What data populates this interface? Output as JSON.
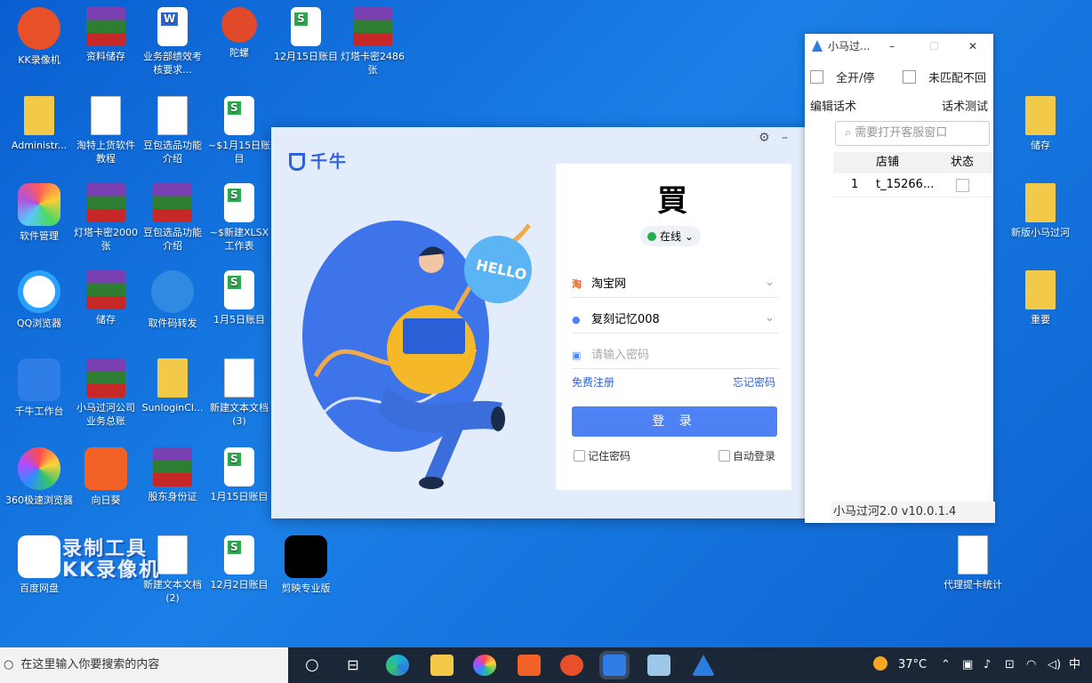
{
  "desktop_icons": [
    {
      "label": "KK录像机",
      "icon": "kk-recorder-icon"
    },
    {
      "label": "资料储存",
      "icon": "winrar-archive-icon"
    },
    {
      "label": "业务部绩效考核要求...",
      "icon": "word-doc-icon"
    },
    {
      "label": "陀螺",
      "icon": "spinning-top-icon"
    },
    {
      "label": "12月15日账目",
      "icon": "spreadsheet-icon"
    },
    {
      "label": "灯塔卡密2486张",
      "icon": "winrar-archive-icon"
    },
    {
      "label": "Administr...",
      "icon": "user-folder-icon"
    },
    {
      "label": "淘特上货软件教程",
      "icon": "video-file-icon"
    },
    {
      "label": "豆包选品功能介绍",
      "icon": "video-file-icon"
    },
    {
      "label": "~$1月15日账目",
      "icon": "spreadsheet-icon"
    },
    {
      "label": "软件管理",
      "icon": "software-manager-icon"
    },
    {
      "label": "灯塔卡密2000张",
      "icon": "winrar-archive-icon"
    },
    {
      "label": "豆包选品功能介绍",
      "icon": "winrar-archive-icon"
    },
    {
      "label": "~$新建XLSX 工作表",
      "icon": "spreadsheet-icon"
    },
    {
      "label": "QQ浏览器",
      "icon": "qq-browser-icon"
    },
    {
      "label": "储存",
      "icon": "winrar-archive-icon"
    },
    {
      "label": "取件码转发",
      "icon": "send-app-icon"
    },
    {
      "label": "1月5日账目",
      "icon": "spreadsheet-icon"
    },
    {
      "label": "千牛工作台",
      "icon": "qianniu-icon"
    },
    {
      "label": "小马过河公司业务总账",
      "icon": "winrar-archive-icon"
    },
    {
      "label": "SunloginCl...",
      "icon": "folder-icon"
    },
    {
      "label": "新建文本文档 (3)",
      "icon": "text-file-icon"
    },
    {
      "label": "360极速浏览器",
      "icon": "360-browser-icon"
    },
    {
      "label": "向日葵",
      "icon": "sunlogin-icon"
    },
    {
      "label": "股东身份证",
      "icon": "winrar-archive-icon"
    },
    {
      "label": "1月15日账目",
      "icon": "spreadsheet-icon"
    },
    {
      "label": "百度网盘",
      "icon": "baidu-netdisk-icon"
    },
    {
      "label": "新建文本文档 (2)",
      "icon": "text-file-icon"
    },
    {
      "label": "12月2日账目",
      "icon": "spreadsheet-icon"
    },
    {
      "label": "剪映专业版",
      "icon": "capcut-icon"
    },
    {
      "label": "储存",
      "icon": "folder-icon"
    },
    {
      "label": "新版小马过河",
      "icon": "folder-icon"
    },
    {
      "label": "重要",
      "icon": "folder-icon"
    },
    {
      "label": "代理提卡统计",
      "icon": "text-file-icon"
    }
  ],
  "watermark": {
    "line1": "录制工具",
    "line2": "KK录像机"
  },
  "qianniu": {
    "brand": "千牛",
    "hello": "HELLO",
    "logo_char": "買",
    "status": "在线",
    "site": "淘宝网",
    "account": "复刻记忆008",
    "password_placeholder": "请输入密码",
    "register": "免费注册",
    "forgot": "忘记密码",
    "login": "登 录",
    "remember": "记住密码",
    "auto_login": "自动登录"
  },
  "xiaoma": {
    "title": "小马过...",
    "toggle_all": "全开/停",
    "unmatched": "未匹配不回",
    "edit_script": "编辑话术",
    "test_script": "话术测试",
    "search_placeholder": "需要打开客服窗口",
    "columns": [
      "店铺",
      "状态"
    ],
    "rows": [
      {
        "index": "1",
        "shop": "t_15266..."
      }
    ],
    "footer": "小马过河2.0 v10.0.1.4"
  },
  "taskbar": {
    "search_placeholder": "在这里输入你要搜索的内容",
    "temperature": "37°C",
    "ime": "中"
  },
  "colors": {
    "desktop": "#1a7fe6",
    "accent": "#4e82f4",
    "taskbar": "#1b2636"
  }
}
